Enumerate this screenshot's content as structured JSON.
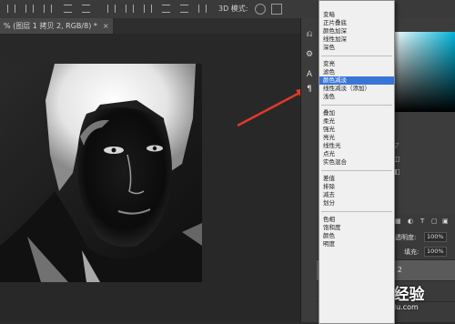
{
  "document_tab": {
    "title": "% (图层 1 拷贝 2, RGB/8) *",
    "close": "×"
  },
  "options_bar": {
    "mode_label": "3D 模式:"
  },
  "blend_menu": {
    "groups": [
      [
        "",
        "变暗",
        "正片叠底",
        "颜色加深",
        "线性加深",
        "深色"
      ],
      [
        "变亮",
        "滤色",
        "颜色减淡",
        "线性减淡（添加）",
        "浅色"
      ],
      [
        "叠加",
        "柔光",
        "强光",
        "亮光",
        "线性光",
        "点光",
        "实色混合"
      ],
      [
        "差值",
        "排除",
        "减去",
        "划分"
      ],
      [
        "色相",
        "饱和度",
        "颜色",
        "明度"
      ]
    ],
    "selected": "颜色减淡"
  },
  "layers": {
    "opacity_label": "透明度:",
    "opacity_value": "100%",
    "fill_label": "填充:",
    "fill_value": "100%",
    "rows": [
      {
        "name": "图层 1 拷贝 2"
      },
      {
        "name": ""
      },
      {
        "name": ""
      }
    ]
  },
  "watermark": {
    "brand": "Baidu经验",
    "url": "jingyan.baidu.com"
  },
  "colors": {
    "menu_highlight": "#3875d7",
    "arrow": "#e03a2a",
    "panel_bg": "#3c3c3c"
  }
}
